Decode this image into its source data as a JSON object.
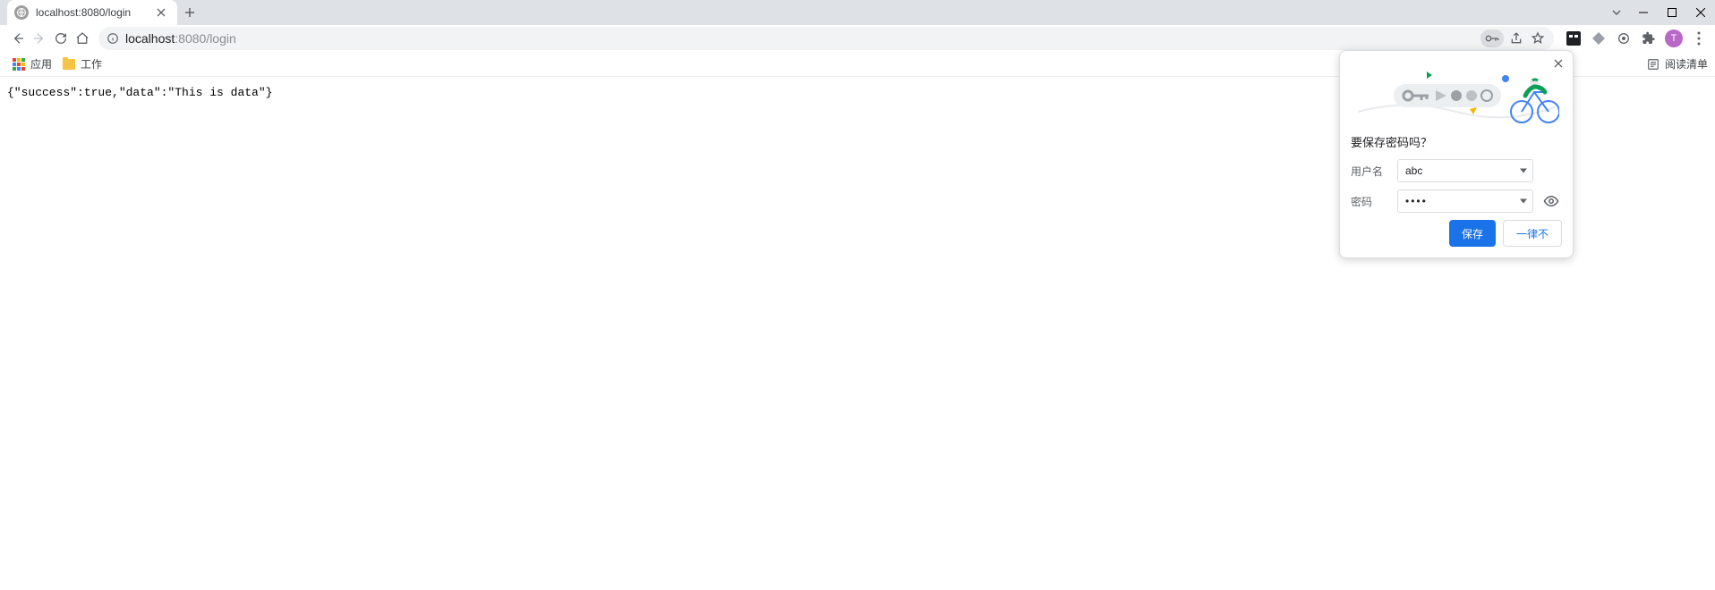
{
  "tab": {
    "title": "localhost:8080/login"
  },
  "address": {
    "host": "localhost",
    "port_path": ":8080/login"
  },
  "bookmarks": {
    "apps": "应用",
    "folder1": "工作",
    "reading_list": "阅读清单"
  },
  "page": {
    "body_text": "{\"success\":true,\"data\":\"This is data\"}"
  },
  "avatar_initial": "T",
  "popup": {
    "title": "要保存密码吗？",
    "username_label": "用户名",
    "username_value": "abc",
    "password_label": "密码",
    "password_masked": "••••",
    "save": "保存",
    "never": "一律不"
  }
}
